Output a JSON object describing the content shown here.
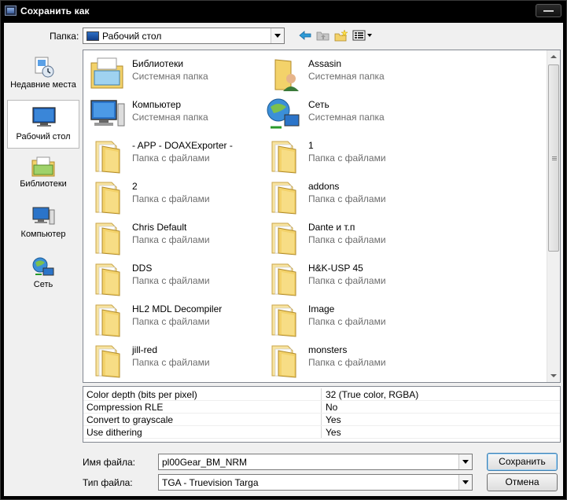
{
  "window": {
    "title": "Сохранить как"
  },
  "top": {
    "folder_label": "Папка:",
    "folder_value": "Рабочий стол"
  },
  "places": [
    {
      "label": "Недавние места",
      "icon": "recent-places-icon"
    },
    {
      "label": "Рабочий стол",
      "icon": "desktop-icon"
    },
    {
      "label": "Библиотеки",
      "icon": "libraries-icon"
    },
    {
      "label": "Компьютер",
      "icon": "computer-icon"
    },
    {
      "label": "Сеть",
      "icon": "network-icon"
    }
  ],
  "files": [
    {
      "name": "Библиотеки",
      "type": "Системная папка",
      "icon": "libraries-icon"
    },
    {
      "name": "Assasin",
      "type": "Системная папка",
      "icon": "user-folder-icon"
    },
    {
      "name": "Компьютер",
      "type": "Системная папка",
      "icon": "computer-icon"
    },
    {
      "name": "Сеть",
      "type": "Системная папка",
      "icon": "network-icon"
    },
    {
      "name": "- APP - DOAXExporter -",
      "type": "Папка с файлами",
      "icon": "folder-icon"
    },
    {
      "name": "1",
      "type": "Папка с файлами",
      "icon": "folder-icon"
    },
    {
      "name": "2",
      "type": "Папка с файлами",
      "icon": "folder-icon"
    },
    {
      "name": "addons",
      "type": "Папка с файлами",
      "icon": "folder-icon"
    },
    {
      "name": "Chris Default",
      "type": "Папка с файлами",
      "icon": "folder-icon"
    },
    {
      "name": "Dante и т.п",
      "type": "Папка с файлами",
      "icon": "folder-icon"
    },
    {
      "name": "DDS",
      "type": "Папка с файлами",
      "icon": "folder-icon"
    },
    {
      "name": "H&K-USP 45",
      "type": "Папка с файлами",
      "icon": "folder-icon"
    },
    {
      "name": "HL2 MDL Decompiler",
      "type": "Папка с файлами",
      "icon": "folder-icon"
    },
    {
      "name": "Image",
      "type": "Папка с файлами",
      "icon": "folder-icon"
    },
    {
      "name": "jill-red",
      "type": "Папка с файлами",
      "icon": "folder-icon"
    },
    {
      "name": "monsters",
      "type": "Папка с файлами",
      "icon": "folder-icon"
    }
  ],
  "properties": [
    {
      "key": "Color depth (bits per pixel)",
      "value": "32 (True color, RGBA)"
    },
    {
      "key": "Compression RLE",
      "value": "No"
    },
    {
      "key": "Convert to grayscale",
      "value": "Yes"
    },
    {
      "key": "Use dithering",
      "value": "Yes"
    }
  ],
  "bottom": {
    "filename_label": "Имя файла:",
    "filename_value": "pl00Gear_BM_NRM",
    "filetype_label": "Тип файла:",
    "filetype_value": "TGA - Truevision Targa",
    "save_label": "Сохранить",
    "cancel_label": "Отмена"
  },
  "colors": {
    "folder_yellow": "#f3d26a",
    "selection_border": "#b9b9b9",
    "accent_blue": "#3c7fb1"
  }
}
